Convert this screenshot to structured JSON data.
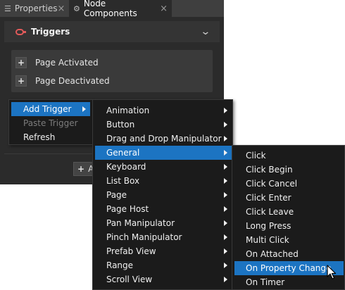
{
  "tabs": [
    {
      "icon": "properties-icon",
      "label": "Properties",
      "close": "×"
    },
    {
      "icon": "node-components-icon",
      "label": "Node Components",
      "close": "×"
    }
  ],
  "triggers": {
    "title": "Triggers",
    "items": [
      "Page Activated",
      "Page Deactivated"
    ],
    "add_label": "A"
  },
  "context_menu": [
    {
      "label": "Add Trigger",
      "highlighted": true,
      "submenu": true
    },
    {
      "label": "Paste Trigger",
      "disabled": true
    },
    {
      "label": "Refresh"
    }
  ],
  "categories_menu": [
    "Animation",
    "Button",
    "Drag and Drop Manipulator",
    "General",
    "Keyboard",
    "List Box",
    "Page",
    "Page Host",
    "Pan Manipulator",
    "Pinch Manipulator",
    "Prefab View",
    "Range",
    "Scroll View"
  ],
  "categories_highlighted": "General",
  "general_menu": [
    "Click",
    "Click Begin",
    "Click Cancel",
    "Click Enter",
    "Click Leave",
    "Long Press",
    "Multi Click",
    "On Attached",
    "On Property Change",
    "On Timer"
  ],
  "general_highlighted": "On Property Change",
  "colors": {
    "highlight": "#1c74c2",
    "menu_bg": "#1b1b1b",
    "panel_bg": "#2b2b2b",
    "trigger_icon": "#e05a5a"
  }
}
